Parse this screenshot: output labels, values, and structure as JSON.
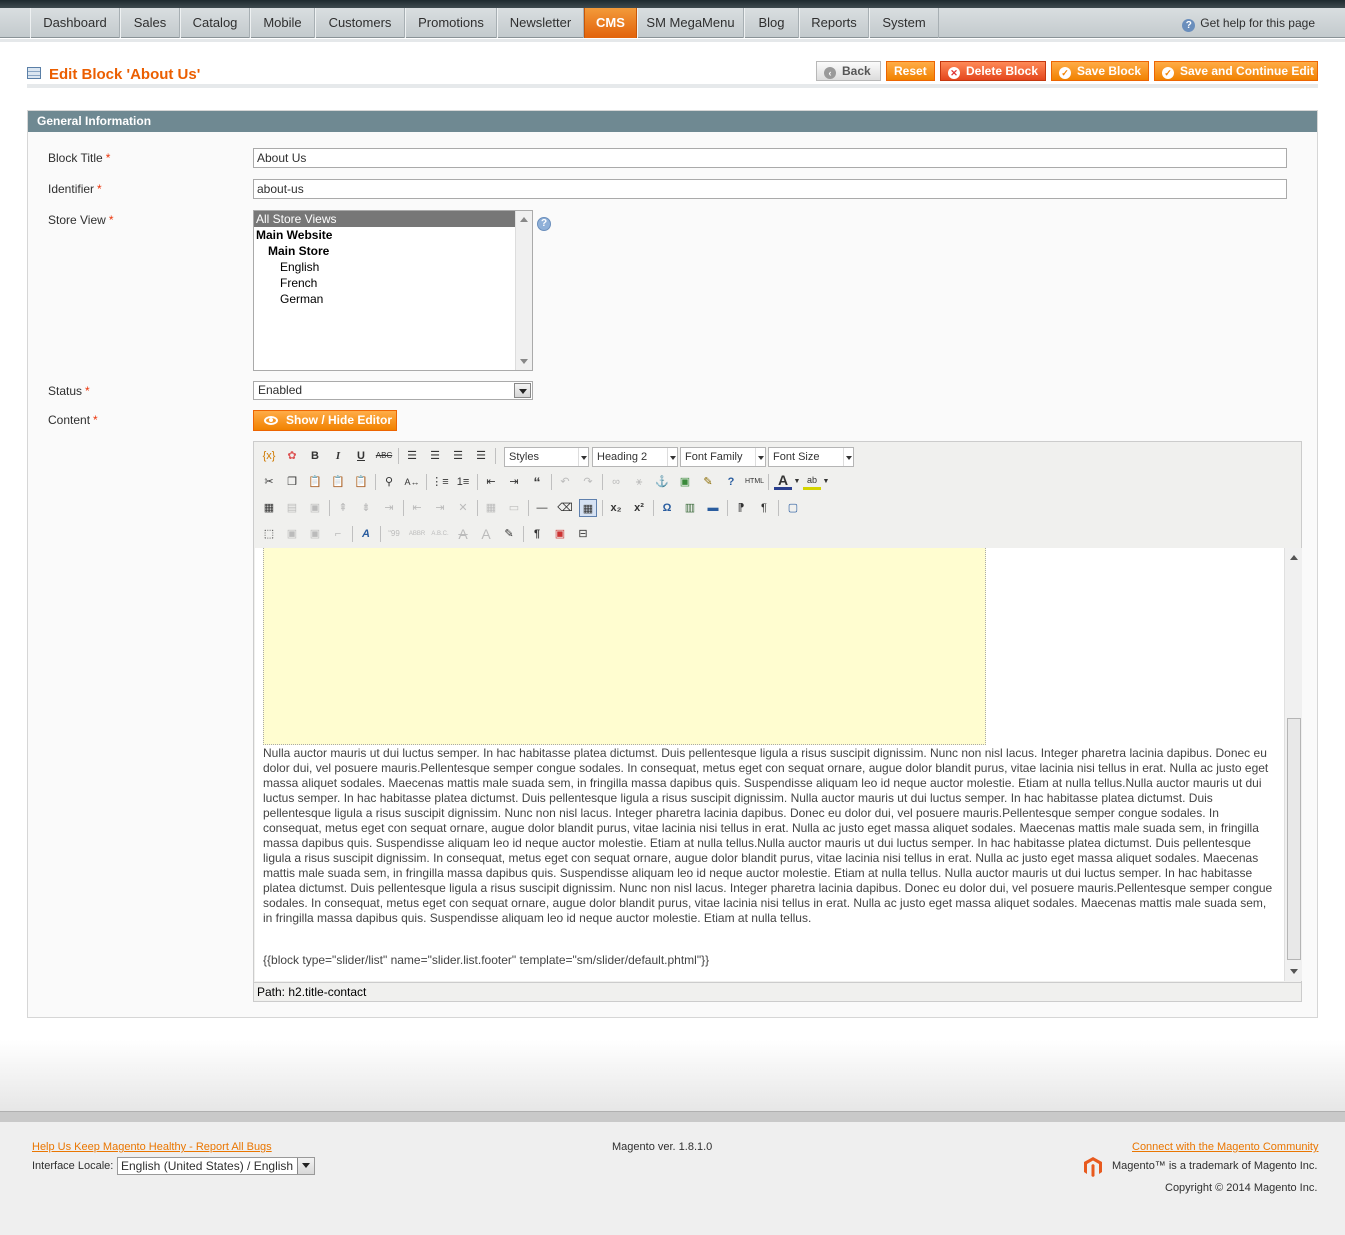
{
  "nav": {
    "items": [
      "Dashboard",
      "Sales",
      "Catalog",
      "Mobile",
      "Customers",
      "Promotions",
      "Newsletter",
      "CMS",
      "SM MegaMenu",
      "Blog",
      "Reports",
      "System"
    ],
    "active": "CMS",
    "help": "Get help for this page"
  },
  "header": {
    "title": "Edit Block 'About Us'",
    "buttons": {
      "back": "Back",
      "reset": "Reset",
      "delete": "Delete Block",
      "save": "Save Block",
      "save_continue": "Save and Continue Edit"
    }
  },
  "section": {
    "title": "General Information"
  },
  "form": {
    "block_title": {
      "label": "Block Title",
      "value": "About Us"
    },
    "identifier": {
      "label": "Identifier",
      "value": "about-us"
    },
    "store_view": {
      "label": "Store View",
      "options": [
        "All Store Views",
        "Main Website",
        "Main Store",
        "English",
        "French",
        "German"
      ],
      "selected": "All Store Views"
    },
    "status": {
      "label": "Status",
      "value": "Enabled"
    },
    "content": {
      "label": "Content",
      "toggle": "Show / Hide Editor"
    },
    "required_mark": "*"
  },
  "editor": {
    "styles": "Styles",
    "format": "Heading 2",
    "font_family": "Font Family",
    "font_size": "Font Size",
    "body": "Nulla auctor mauris ut dui luctus semper. In hac habitasse platea dictumst. Duis pellentesque ligula a risus suscipit dignissim. Nunc non nisl lacus. Integer pharetra lacinia dapibus. Donec eu dolor dui, vel posuere mauris.Pellentesque semper congue sodales. In consequat, metus eget con sequat ornare, augue dolor blandit purus, vitae lacinia nisi tellus in erat. Nulla ac justo eget massa aliquet sodales. Maecenas mattis male suada sem, in fringilla massa dapibus quis. Suspendisse aliquam leo id neque auctor molestie. Etiam at nulla tellus.Nulla auctor mauris ut dui luctus semper. In hac habitasse platea dictumst. Duis pellentesque ligula a risus suscipit dignissim. Nulla auctor mauris ut dui luctus semper. In hac habitasse platea dictumst. Duis pellentesque ligula a risus suscipit dignissim. Nunc non nisl lacus. Integer pharetra lacinia dapibus. Donec eu dolor dui, vel posuere mauris.Pellentesque semper congue sodales. In consequat, metus eget con sequat ornare, augue dolor blandit purus, vitae lacinia nisi tellus in erat. Nulla ac justo eget massa aliquet sodales. Maecenas mattis male suada sem, in fringilla massa dapibus quis. Suspendisse aliquam leo id neque auctor molestie. Etiam at nulla tellus.Nulla auctor mauris ut dui luctus semper. In hac habitasse platea dictumst. Duis pellentesque ligula a risus suscipit dignissim. In consequat, metus eget con sequat ornare, augue dolor blandit purus, vitae lacinia nisi tellus in erat. Nulla ac justo eget massa aliquet sodales. Maecenas mattis male suada sem, in fringilla massa dapibus quis. Suspendisse aliquam leo id neque auctor molestie. Etiam at nulla tellus. Nulla auctor mauris ut dui luctus semper. In hac habitasse platea dictumst. Duis pellentesque ligula a risus suscipit dignissim. Nunc non nisl lacus. Integer pharetra lacinia dapibus. Donec eu dolor dui, vel posuere mauris.Pellentesque semper congue sodales. In consequat, metus eget con sequat ornare, augue dolor blandit purus, vitae lacinia nisi tellus in erat. Nulla ac justo eget massa aliquet sodales. Maecenas mattis male suada sem, in fringilla massa dapibus quis. Suspendisse aliquam leo id neque auctor molestie. Etiam at nulla tellus.",
    "widget": "{{block type=\"slider/list\" name=\"slider.list.footer\" template=\"sm/slider/default.phtml\"}}",
    "path": "Path: h2.title-contact"
  },
  "footer": {
    "bug_link": "Help Us Keep Magento Healthy - Report All Bugs",
    "locale_label": "Interface Locale:",
    "locale_value": "English (United States) / English",
    "version": "Magento ver. 1.8.1.0",
    "community_link": "Connect with the Magento Community",
    "trademark": "Magento™ is a trademark of Magento Inc.",
    "copyright": "Copyright © 2014 Magento Inc."
  },
  "colors": {
    "accent": "#eb5e00",
    "nav_active": "#e2620a",
    "section_header": "#6f8992",
    "editor_highlight": "#fffdd0"
  }
}
